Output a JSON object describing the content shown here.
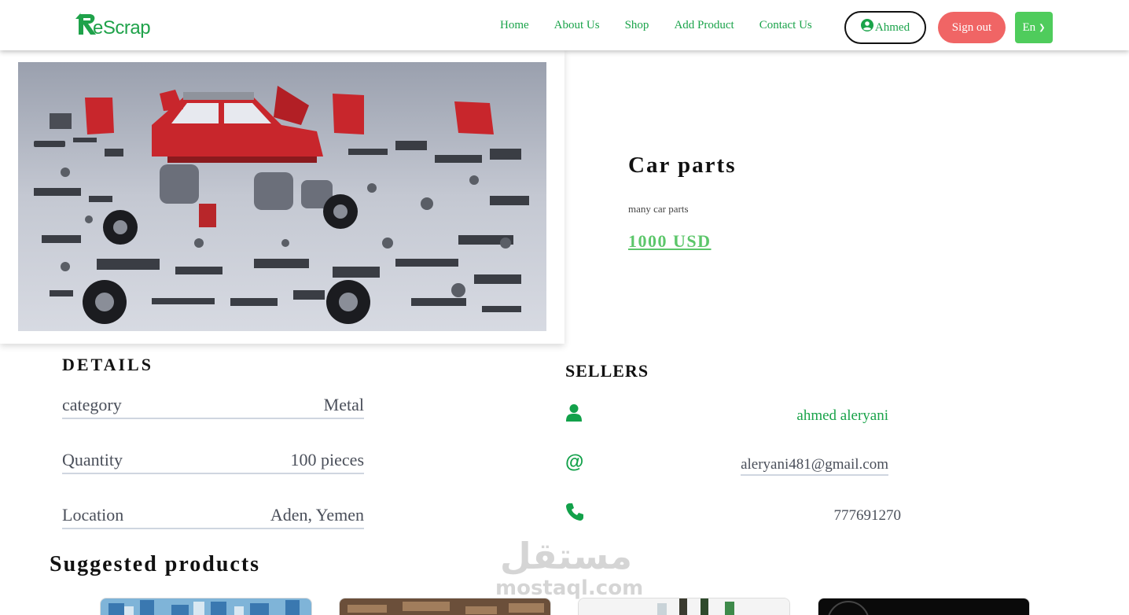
{
  "brand": {
    "logo_text": "eScrap",
    "accent_color": "#1fa24a"
  },
  "nav": {
    "links": [
      "Home",
      "About Us",
      "Shop",
      "Add Product",
      "Contact Us"
    ],
    "user_label": "Ahmed",
    "signout_label": "Sign out",
    "language": "En",
    "signout_color": "#f06565",
    "language_color": "#4fcc5c"
  },
  "product": {
    "title": "Car parts",
    "description": "many car parts",
    "price": "1000 USD",
    "image_icon": "car-parts-photo"
  },
  "details": {
    "title": "DETAILS",
    "rows": [
      {
        "label": "category",
        "value": "Metal"
      },
      {
        "label": "Quantity",
        "value": "100 pieces"
      },
      {
        "label": "Location",
        "value": "Aden, Yemen"
      }
    ]
  },
  "sellers": {
    "title": "SELLERS",
    "name": "ahmed aleryani",
    "email": "aleryani481@gmail.com",
    "phone": "777691270",
    "icons": [
      "user-icon",
      "at-icon",
      "phone-icon"
    ]
  },
  "suggested": {
    "title": "Suggested products",
    "items": [
      "plastic-bottles-thumbnail",
      "wood-scrap-thumbnail",
      "glass-bottles-thumbnail",
      "dark-product-thumbnail"
    ]
  },
  "watermark": {
    "arabic": "مستقل",
    "latin": "mostaql.com"
  }
}
